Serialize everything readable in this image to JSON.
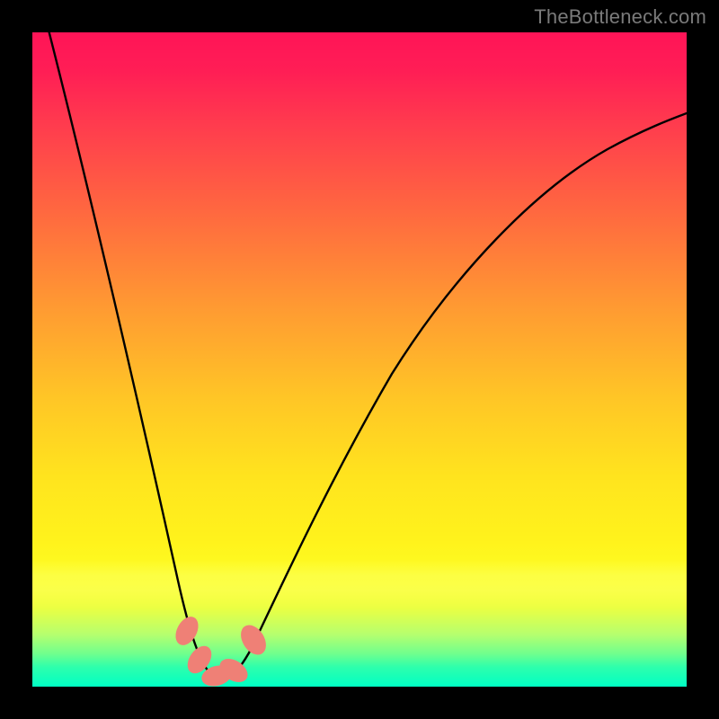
{
  "watermark": {
    "text": "TheBottleneck.com"
  },
  "chart_data": {
    "type": "line",
    "title": "",
    "xlabel": "",
    "ylabel": "",
    "xlim": [
      0,
      100
    ],
    "ylim": [
      0,
      100
    ],
    "grid": false,
    "legend": false,
    "background_gradient": {
      "stops": [
        {
          "pos": 0,
          "color": "#ff1457"
        },
        {
          "pos": 50,
          "color": "#ffb028"
        },
        {
          "pos": 82,
          "color": "#fcff40"
        },
        {
          "pos": 100,
          "color": "#00ffc8"
        }
      ]
    },
    "series": [
      {
        "name": "bottleneck-curve",
        "color": "#000000",
        "x": [
          0,
          4,
          8,
          12,
          16,
          20,
          22,
          24,
          26,
          27,
          28,
          29,
          30,
          31,
          33,
          36,
          40,
          45,
          52,
          60,
          70,
          82,
          94,
          100
        ],
        "y": [
          105,
          92,
          78,
          63,
          48,
          31,
          22,
          14,
          7,
          4,
          2,
          1.2,
          1.5,
          2.5,
          6,
          13,
          24,
          37,
          52,
          65,
          76,
          85,
          90,
          92
        ]
      }
    ],
    "markers": [
      {
        "x": 23.5,
        "y": 8.5,
        "rx": 2.4,
        "ry": 1.6,
        "angle": -60,
        "color": "#f08378"
      },
      {
        "x": 25.5,
        "y": 4.0,
        "rx": 2.4,
        "ry": 1.6,
        "angle": -55,
        "color": "#f08378"
      },
      {
        "x": 28.0,
        "y": 1.6,
        "rx": 2.4,
        "ry": 1.6,
        "angle": -20,
        "color": "#f08378"
      },
      {
        "x": 30.5,
        "y": 2.2,
        "rx": 2.4,
        "ry": 1.6,
        "angle": 30,
        "color": "#f08378"
      },
      {
        "x": 33.5,
        "y": 7.0,
        "rx": 2.6,
        "ry": 1.7,
        "angle": 58,
        "color": "#f08378"
      }
    ]
  }
}
